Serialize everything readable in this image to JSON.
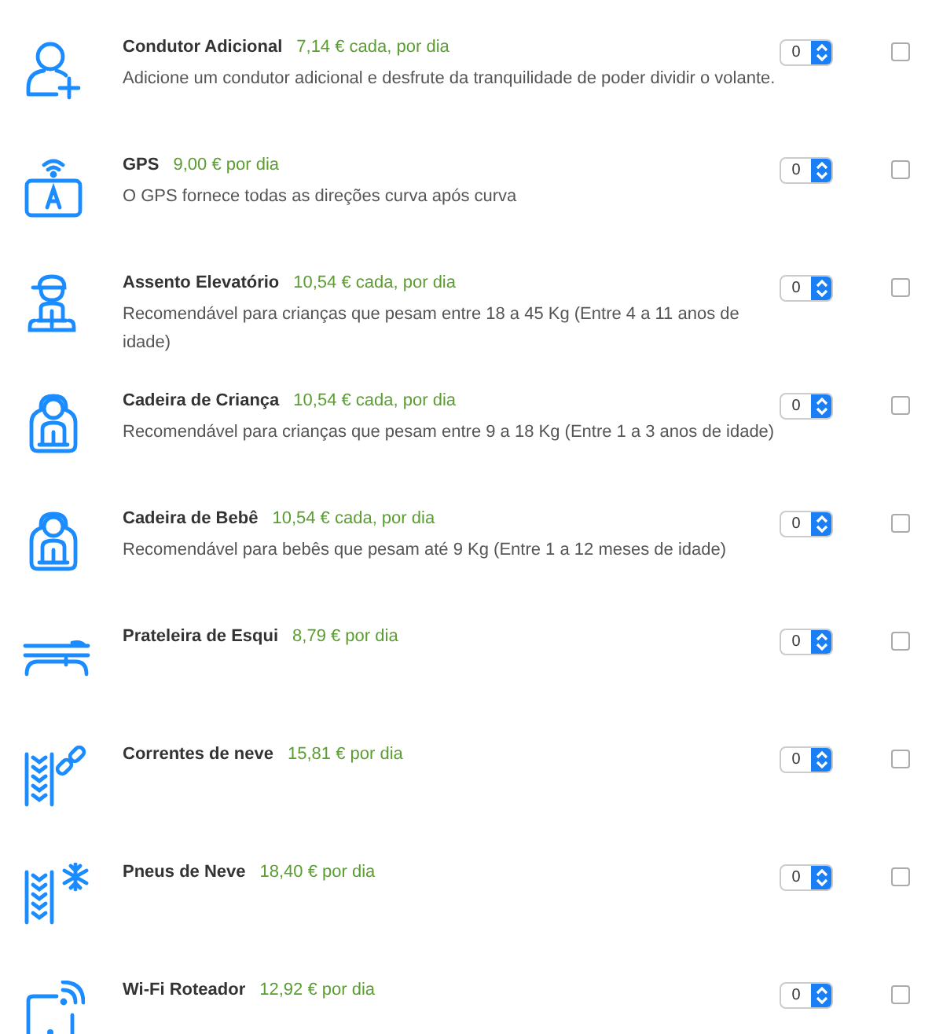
{
  "extras": [
    {
      "title": "Condutor Adicional",
      "price": "7,14 € cada, por dia",
      "description": "Adicione um condutor adicional e desfrute da tranquilidade de poder dividir o volante.",
      "quantity": "0",
      "checked": false
    },
    {
      "title": "GPS",
      "price": "9,00 € por dia",
      "description": "O GPS fornece todas as direções curva após curva",
      "quantity": "0",
      "checked": false
    },
    {
      "title": "Assento Elevatório",
      "price": "10,54 € cada, por dia",
      "description": "Recomendável para crianças que pesam entre 18 a 45 Kg (Entre 4 a 11 anos de idade)",
      "quantity": "0",
      "checked": false
    },
    {
      "title": "Cadeira de Criança",
      "price": "10,54 € cada, por dia",
      "description": "Recomendável para crianças que pesam entre 9 a 18 Kg (Entre 1 a 3 anos de idade)",
      "quantity": "0",
      "checked": false
    },
    {
      "title": "Cadeira de Bebê",
      "price": "10,54 € cada, por dia",
      "description": "Recomendável para bebês que pesam até 9 Kg (Entre 1 a 12 meses de idade)",
      "quantity": "0",
      "checked": false
    },
    {
      "title": "Prateleira de Esqui",
      "price": "8,79 € por dia",
      "quantity": "0",
      "checked": false
    },
    {
      "title": "Correntes de neve",
      "price": "15,81 € por dia",
      "quantity": "0",
      "checked": false
    },
    {
      "title": "Pneus de Neve",
      "price": "18,40 € por dia",
      "quantity": "0",
      "checked": false
    },
    {
      "title": "Wi-Fi Roteador",
      "price": "12,92 € por dia",
      "quantity": "0",
      "checked": false
    }
  ]
}
